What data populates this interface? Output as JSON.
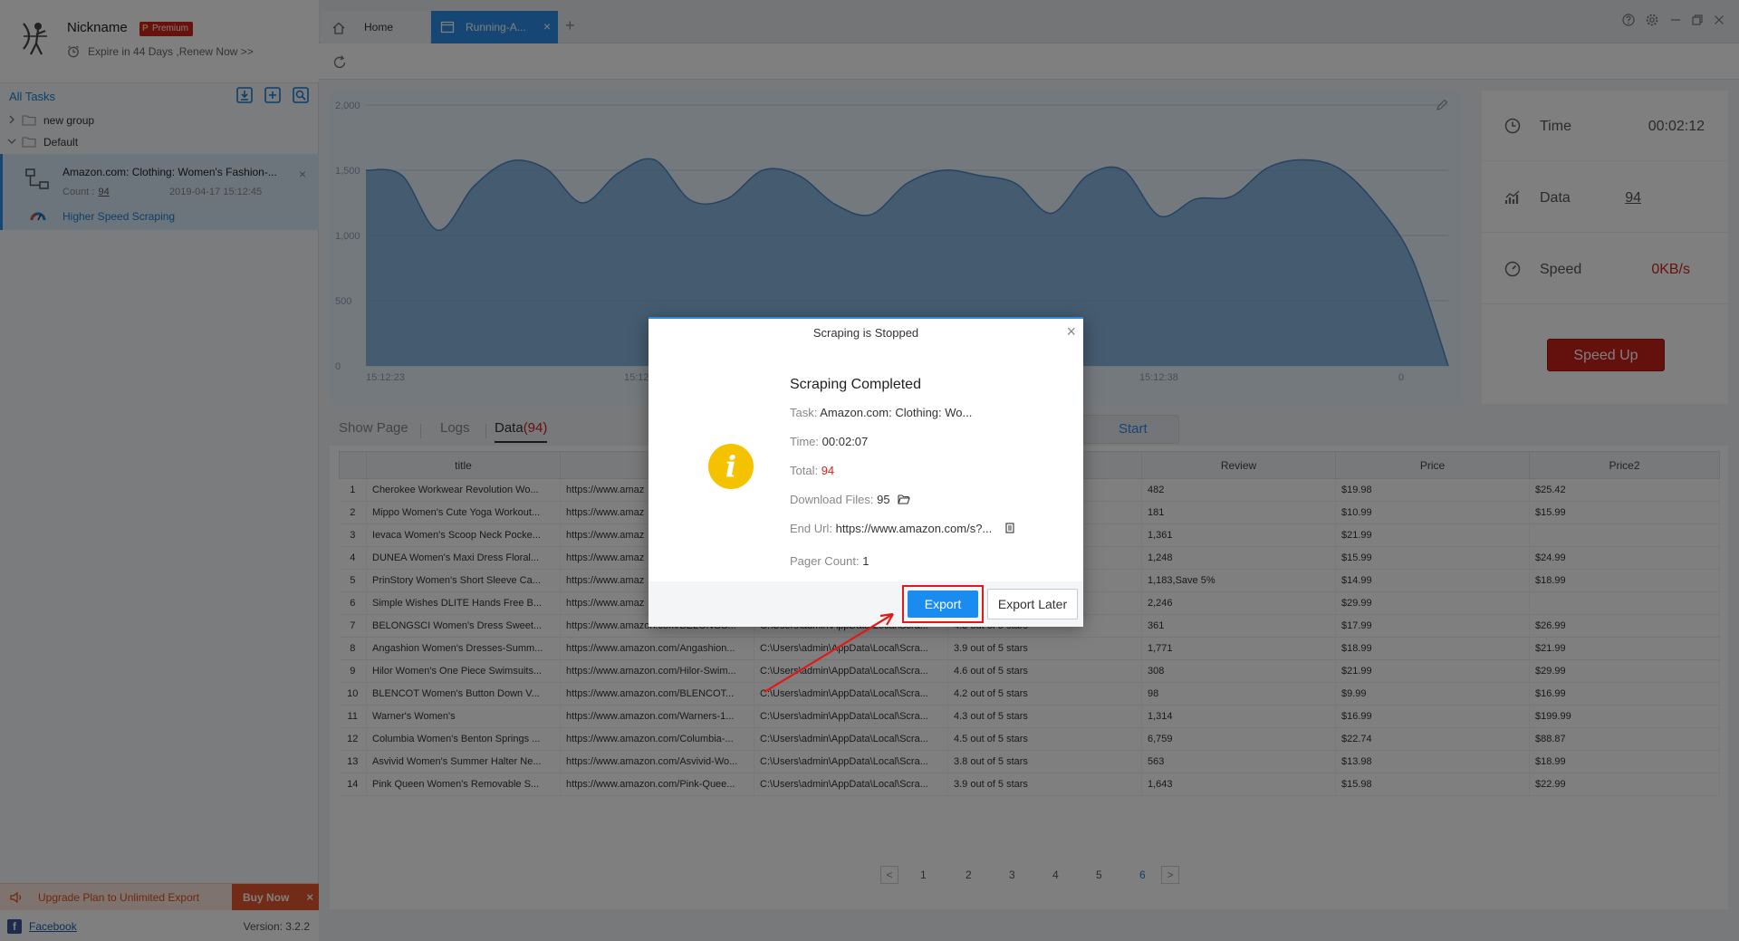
{
  "profile": {
    "nickname": "Nickname",
    "badge": "Premium",
    "expire": "Expire in 44 Days ,Renew Now >>"
  },
  "tasks": {
    "header": "All Tasks",
    "groups": [
      "new group",
      "Default"
    ],
    "task": {
      "title": "Amazon.com: Clothing: Women's Fashion-...",
      "count_label": "Count :",
      "count": "94",
      "date": "2019-04-17 15:12:45",
      "mode": "Higher Speed Scraping"
    }
  },
  "upgrade": {
    "text": "Upgrade Plan to Unlimited Export",
    "buy": "Buy Now"
  },
  "footer": {
    "facebook": "Facebook",
    "version": "Version: 3.2.2"
  },
  "tabs": {
    "home": "Home",
    "running": "Running-A..."
  },
  "stats": {
    "time_label": "Time",
    "time_value": "00:02:12",
    "data_label": "Data",
    "data_value": "94",
    "speed_label": "Speed",
    "speed_value": "0KB/s",
    "speed_up": "Speed Up",
    "speed_color": "#d0241d"
  },
  "content_tabs": {
    "show_page": "Show Page",
    "logs": "Logs",
    "data": "Data",
    "data_count": "(94)",
    "start": "Start"
  },
  "table": {
    "columns": [
      "",
      "title",
      "title",
      "",
      "",
      "",
      "Review",
      "Price",
      "Price2"
    ],
    "rows": [
      [
        "1",
        "Cherokee Workwear Revolution Wo...",
        "https://www.amaz",
        "",
        "",
        "",
        "482",
        "$19.98",
        "$25.42"
      ],
      [
        "2",
        "Mippo Women's Cute Yoga Workout...",
        "https://www.amaz",
        "",
        "",
        "",
        "181",
        "$10.99",
        "$15.99"
      ],
      [
        "3",
        "Ievaca Women's Scoop Neck Pocke...",
        "https://www.amaz",
        "",
        "",
        "",
        "1,361",
        "$21.99",
        ""
      ],
      [
        "4",
        "DUNEA Women's Maxi Dress Floral...",
        "https://www.amaz",
        "",
        "",
        "",
        "1,248",
        "$15.99",
        "$24.99"
      ],
      [
        "5",
        "PrinStory Women's Short Sleeve Ca...",
        "https://www.amaz",
        "",
        "",
        "",
        "1,183,Save 5%",
        "$14.99",
        "$18.99"
      ],
      [
        "6",
        "Simple Wishes DLITE Hands Free B...",
        "https://www.amaz",
        "",
        "",
        "",
        "2,246",
        "$29.99",
        ""
      ],
      [
        "7",
        "BELONGSCI Women's Dress Sweet...",
        "https://www.amazon.com/BELONGS...",
        "C:\\Users\\admin\\AppData\\Local\\Scra...",
        "4.3 out of 5 stars",
        "",
        "361",
        "$17.99",
        "$26.99"
      ],
      [
        "8",
        "Angashion Women's Dresses-Summ...",
        "https://www.amazon.com/Angashion...",
        "C:\\Users\\admin\\AppData\\Local\\Scra...",
        "3.9 out of 5 stars",
        "",
        "1,771",
        "$18.99",
        "$21.99"
      ],
      [
        "9",
        "Hilor Women's One Piece Swimsuits...",
        "https://www.amazon.com/Hilor-Swim...",
        "C:\\Users\\admin\\AppData\\Local\\Scra...",
        "4.6 out of 5 stars",
        "",
        "308",
        "$21.99",
        "$29.99"
      ],
      [
        "10",
        "BLENCOT Women's Button Down V...",
        "https://www.amazon.com/BLENCOT...",
        "C:\\Users\\admin\\AppData\\Local\\Scra...",
        "4.2 out of 5 stars",
        "",
        "98",
        "$9.99",
        "$16.99"
      ],
      [
        "11",
        "Warner's Women's",
        "https://www.amazon.com/Warners-1...",
        "C:\\Users\\admin\\AppData\\Local\\Scra...",
        "4.3 out of 5 stars",
        "",
        "1,314",
        "$16.99",
        "$199.99"
      ],
      [
        "12",
        "Columbia Women's Benton Springs ...",
        "https://www.amazon.com/Columbia-...",
        "C:\\Users\\admin\\AppData\\Local\\Scra...",
        "4.5 out of 5 stars",
        "",
        "6,759",
        "$22.74",
        "$88.87"
      ],
      [
        "13",
        "Asvivid Women's Summer Halter Ne...",
        "https://www.amazon.com/Asvivid-Wo...",
        "C:\\Users\\admin\\AppData\\Local\\Scra...",
        "3.8 out of 5 stars",
        "",
        "563",
        "$13.98",
        "$18.99"
      ],
      [
        "14",
        "Pink Queen Women's Removable S...",
        "https://www.amazon.com/Pink-Quee...",
        "C:\\Users\\admin\\AppData\\Local\\Scra...",
        "3.9 out of 5 stars",
        "",
        "1,643",
        "$15.98",
        "$22.99"
      ]
    ]
  },
  "pager": {
    "pages": [
      "1",
      "2",
      "3",
      "4",
      "5",
      "6"
    ],
    "current": "6",
    "prev": "<",
    "next": ">"
  },
  "chart": {
    "y_ticks": [
      "0",
      "500",
      "1,000",
      "1,500",
      "2,000"
    ],
    "x_ticks": [
      "15:12:23",
      "15:12:2",
      "15:12:38",
      "0"
    ],
    "y_max": 2000,
    "values": [
      1500,
      1460,
      1040,
      1380,
      1570,
      1510,
      1250,
      1480,
      1580,
      1270,
      1280,
      1500,
      1460,
      1240,
      1160,
      1400,
      1500,
      1460,
      1400,
      1170,
      1460,
      1500,
      1150,
      1280,
      1300,
      1520,
      1580,
      1510,
      1240,
      820,
      0
    ]
  },
  "modal": {
    "title": "Scraping is Stopped",
    "heading": "Scraping Completed",
    "task_label": "Task:",
    "task_value": "Amazon.com: Clothing: Wo...",
    "time_label": "Time:",
    "time_value": "00:02:07",
    "total_label": "Total:",
    "total_value": "94",
    "files_label": "Download Files:",
    "files_value": "95",
    "url_label": "End Url:",
    "url_value": "https://www.amazon.com/s?...",
    "pager_label": "Pager Count:",
    "pager_value": "1",
    "export": "Export",
    "export_later": "Export Later"
  }
}
